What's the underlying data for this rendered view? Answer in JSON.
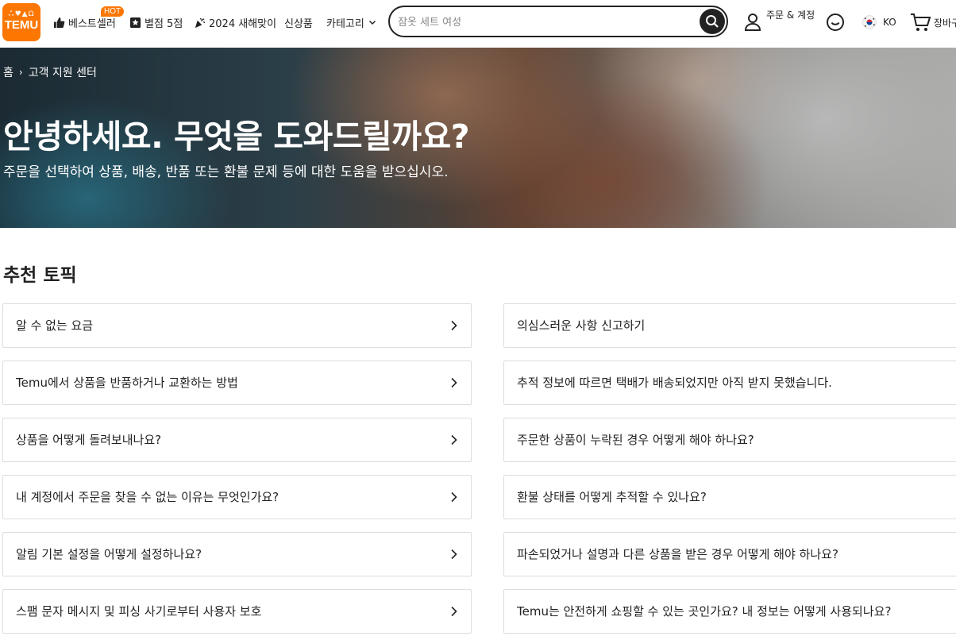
{
  "header": {
    "logo_top": "ஃ♥▲Ω",
    "logo_text": "TEMU",
    "nav": [
      {
        "label": "베스트셀러",
        "icon": "thumbs-up-icon"
      },
      {
        "label": "별점 5점",
        "icon": "star-box-icon"
      },
      {
        "label": "2024 새해맞이",
        "icon": "party-popper-icon"
      },
      {
        "label": "신상품"
      },
      {
        "label": "카테고리",
        "icon": "chevron-down-icon"
      }
    ],
    "hot_badge": "HOT",
    "search": {
      "placeholder": "잠옷 세트 여성"
    },
    "account_label": "주문 & 계정",
    "language": "KO",
    "cart_label": "장바구니"
  },
  "hero": {
    "breadcrumb": [
      "홈",
      "고객 지원 센터"
    ],
    "title": "안녕하세요. 무엇을 도와드릴까요?",
    "subtitle": "주문을 선택하여 상품, 배송, 반품 또는 환불 문제 등에 대한 도움을 받으십시오."
  },
  "topics": {
    "title": "추천 토픽",
    "left": [
      "알 수 없는 요금",
      "Temu에서 상품을 반품하거나 교환하는 방법",
      "상품을 어떻게 돌려보내나요?",
      "내 계정에서 주문을 찾을 수 없는 이유는 무엇인가요?",
      "알림 기본 설정을 어떻게 설정하나요?",
      "스팸 문자 메시지 및 피싱 사기로부터 사용자 보호"
    ],
    "right": [
      "의심스러운 사항 신고하기",
      "추적 정보에 따르면 택배가 배송되었지만 아직 받지 못했습니다.",
      "주문한 상품이 누락된 경우 어떻게 해야 하나요?",
      "환불 상태를 어떻게 추적할 수 있나요?",
      "파손되었거나 설명과 다른 상품을 받은 경우 어떻게 해야 하나요?",
      "Temu는 안전하게 쇼핑할 수 있는 곳인가요? 내 정보는 어떻게 사용되나요?"
    ]
  },
  "colors": {
    "brand": "#fb7701",
    "text": "#222222",
    "border": "#dddddd"
  }
}
